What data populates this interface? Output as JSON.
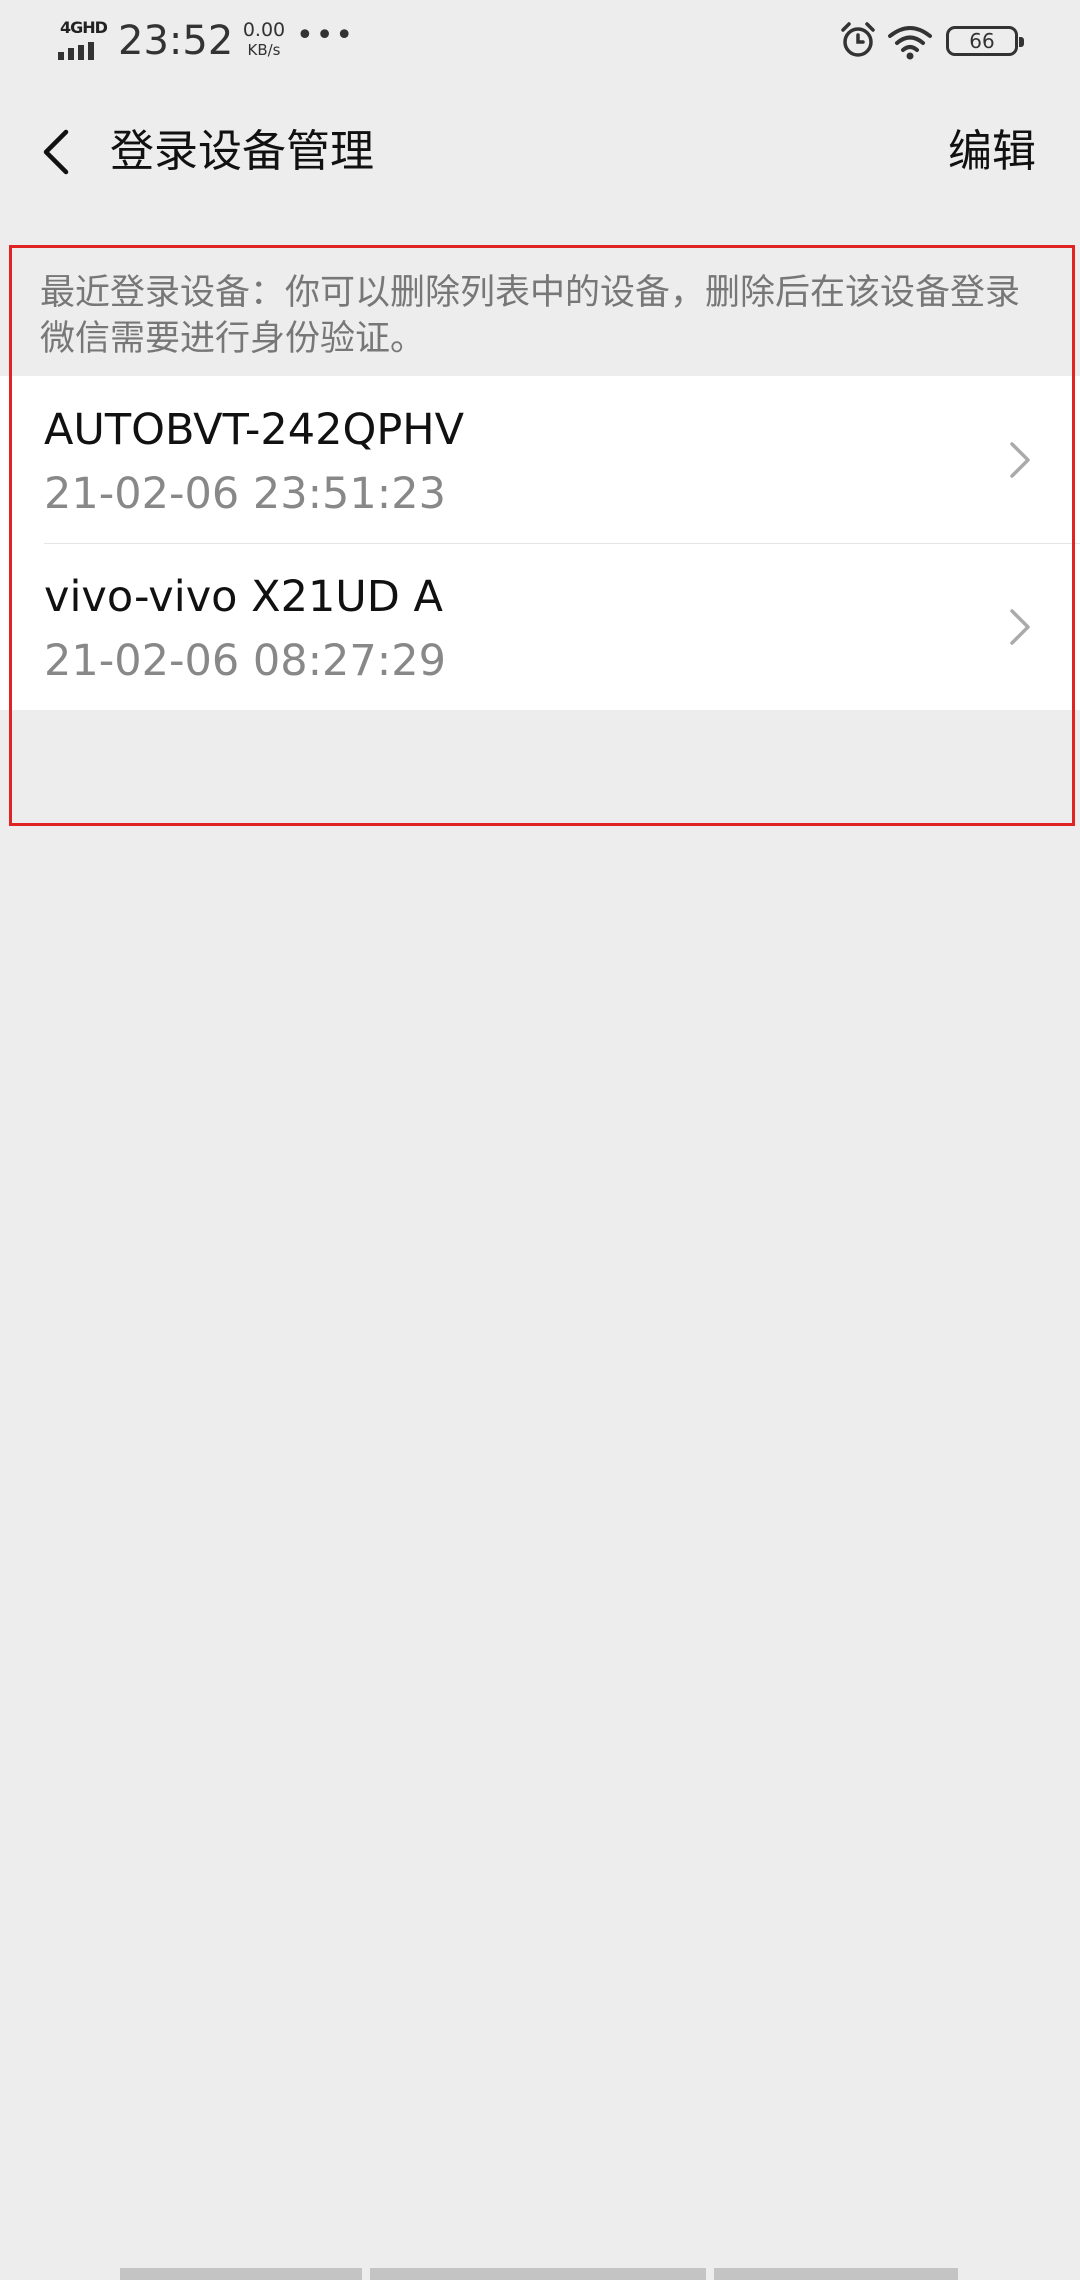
{
  "status_bar": {
    "network": "4GHD",
    "time": "23:52",
    "speed_value": "0.00",
    "speed_unit": "KB/s",
    "more": "•••",
    "battery": "66",
    "icons": [
      "signal-icon",
      "alarm-icon",
      "wifi-icon",
      "battery-icon"
    ]
  },
  "header": {
    "back_icon": "chevron-left-icon",
    "title": "登录设备管理",
    "edit_label": "编辑"
  },
  "tip_text": "最近登录设备：你可以删除列表中的设备，删除后在该设备登录微信需要进行身份验证。",
  "devices": [
    {
      "name": "AUTOBVT-242QPHV",
      "time": "21-02-06 23:51:23"
    },
    {
      "name": "vivo-vivo X21UD A",
      "time": "21-02-06 08:27:29"
    }
  ],
  "colors": {
    "background": "#ededed",
    "highlight": "#e02424",
    "card": "#ffffff"
  }
}
